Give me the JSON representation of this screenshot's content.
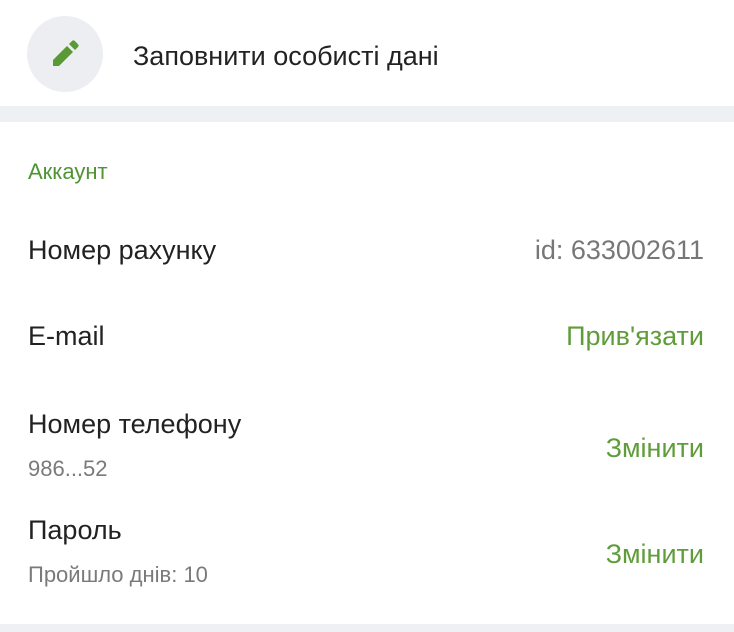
{
  "edit": {
    "label": "Заповнити особисті дані",
    "icon": "pencil-icon",
    "icon_color": "#5a9a35"
  },
  "account": {
    "title": "Аккаунт",
    "rows": [
      {
        "label": "Номер рахунку",
        "sub": "",
        "value": "id: 633002611"
      },
      {
        "label": "E-mail",
        "sub": "",
        "value": "Прив'язати"
      },
      {
        "label": "Номер телефону",
        "sub": "986...52",
        "value": "Змінити"
      },
      {
        "label": "Пароль",
        "sub": "Пройшло днів: 10",
        "value": "Змінити"
      }
    ]
  },
  "colors": {
    "accent": "#5f9c3a",
    "section_title": "#4f9433",
    "muted": "#777777",
    "background": "#eef0f3"
  }
}
